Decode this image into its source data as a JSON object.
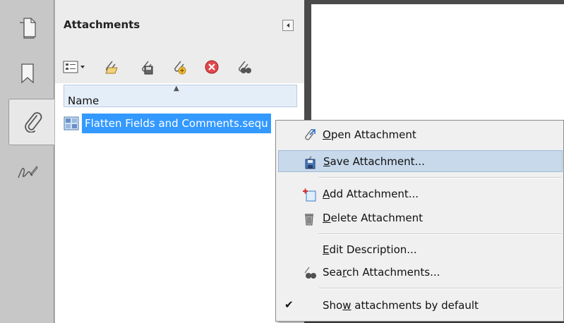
{
  "sidebar": {
    "items": [
      {
        "name": "pages-icon"
      },
      {
        "name": "bookmarks-icon"
      },
      {
        "name": "attachments-icon",
        "active": true
      },
      {
        "name": "signatures-icon"
      }
    ]
  },
  "panel": {
    "title": "Attachments",
    "toolbar": [
      "options-menu-icon",
      "open-attachment-icon",
      "save-attachment-icon",
      "add-attachment-icon",
      "delete-attachment-icon",
      "search-attachments-icon"
    ],
    "column_header": "Name",
    "files": [
      {
        "name": "Flatten Fields and Comments.sequ",
        "selected": true
      }
    ]
  },
  "context_menu": {
    "items": [
      {
        "id": "open",
        "pre": "",
        "key": "O",
        "post": "pen Attachment",
        "icon": "open-attachment-icon"
      },
      {
        "id": "save",
        "pre": "",
        "key": "S",
        "post": "ave Attachment...",
        "icon": "save-attachment-icon",
        "highlighted": true
      },
      {
        "id": "add",
        "pre": "",
        "key": "A",
        "post": "dd Attachment...",
        "icon": "add-attachment-icon"
      },
      {
        "id": "delete",
        "pre": "",
        "key": "D",
        "post": "elete Attachment",
        "icon": "delete-attachment-icon"
      },
      {
        "id": "edit",
        "pre": "",
        "key": "E",
        "post": "dit Description...",
        "icon": ""
      },
      {
        "id": "search",
        "pre": "Sea",
        "key": "r",
        "post": "ch Attachments...",
        "icon": "search-attachments-icon"
      },
      {
        "id": "show",
        "pre": "Sho",
        "key": "w",
        "post": " attachments by default",
        "icon": "",
        "checked": true
      }
    ],
    "check_glyph": "✔"
  },
  "colors": {
    "selection": "#3399ff",
    "menu_highlight": "#c7d9ea"
  }
}
